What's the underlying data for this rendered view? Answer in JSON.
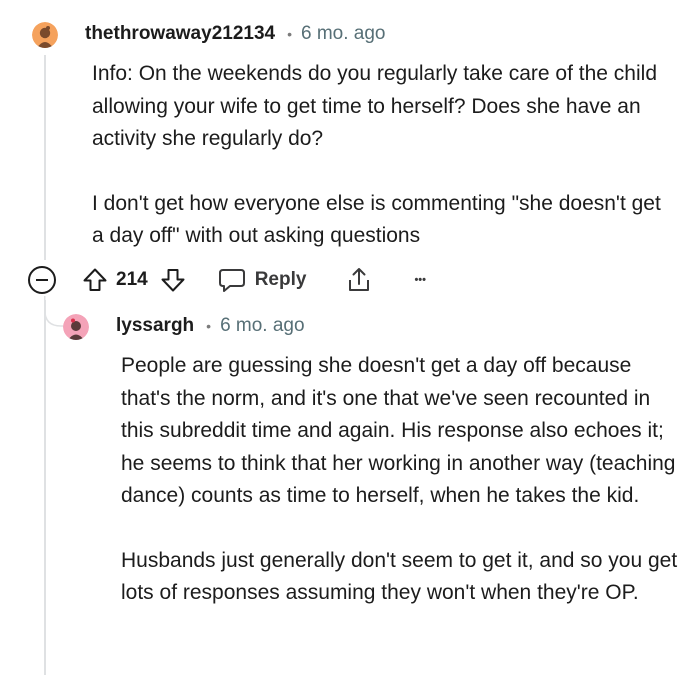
{
  "comment": {
    "username": "thethrowaway212134",
    "separator": "•",
    "time": "6 mo. ago",
    "paragraphs": [
      "Info: On the weekends do you regularly take care of the child allowing your wife to get time to herself? Does she have an activity she regularly do?",
      "I don't get how everyone else is commenting \"she doesn't get a day off\" with out asking questions"
    ],
    "votes": "214",
    "reply_label": "Reply",
    "more_label": "•••",
    "avatar_color": "#f5a25d"
  },
  "reply": {
    "username": "lyssargh",
    "separator": "•",
    "time": "6 mo. ago",
    "paragraphs": [
      "People are guessing she doesn't get a day off because that's the norm, and it's one that we've seen recounted in this subreddit time and again. His response also echoes it; he seems to think that her working in another way (teaching dance) counts as time to herself, when he takes the kid.",
      "Husbands just generally don't seem to get it, and so you get lots of responses assuming they won't when they're OP."
    ],
    "avatar_color": "#f4a3b8"
  }
}
